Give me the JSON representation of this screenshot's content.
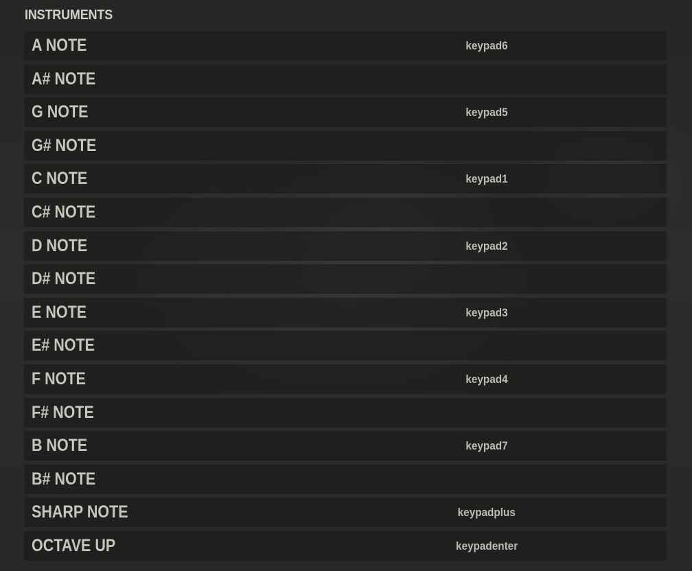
{
  "section": {
    "title": "INSTRUMENTS"
  },
  "bindings": [
    {
      "action": "A NOTE",
      "key": "keypad6"
    },
    {
      "action": "A# NOTE",
      "key": ""
    },
    {
      "action": "G NOTE",
      "key": "keypad5"
    },
    {
      "action": "G# NOTE",
      "key": ""
    },
    {
      "action": "C NOTE",
      "key": "keypad1"
    },
    {
      "action": "C# NOTE",
      "key": ""
    },
    {
      "action": "D NOTE",
      "key": "keypad2"
    },
    {
      "action": "D# NOTE",
      "key": ""
    },
    {
      "action": "E NOTE",
      "key": "keypad3"
    },
    {
      "action": "E# NOTE",
      "key": ""
    },
    {
      "action": "F NOTE",
      "key": "keypad4"
    },
    {
      "action": "F# NOTE",
      "key": ""
    },
    {
      "action": "B NOTE",
      "key": "keypad7"
    },
    {
      "action": "B# NOTE",
      "key": ""
    },
    {
      "action": "SHARP NOTE",
      "key": "keypadplus"
    },
    {
      "action": "OCTAVE UP",
      "key": "keypadenter"
    }
  ]
}
